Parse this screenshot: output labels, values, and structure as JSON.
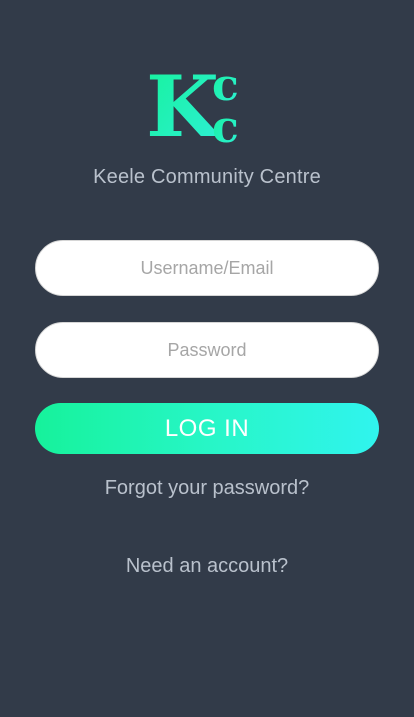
{
  "app": {
    "logo_text": "KCC",
    "name": "Keele Community Centre"
  },
  "login_form": {
    "username_placeholder": "Username/Email",
    "password_placeholder": "Password",
    "submit_label": "LOG IN",
    "forgot_password_label": "Forgot your password?",
    "signup_label": "Need an account?"
  },
  "colors": {
    "background": "#323b49",
    "accent_start": "#16f29b",
    "accent_end": "#30f4ee",
    "muted_text": "#b9c1cc"
  }
}
